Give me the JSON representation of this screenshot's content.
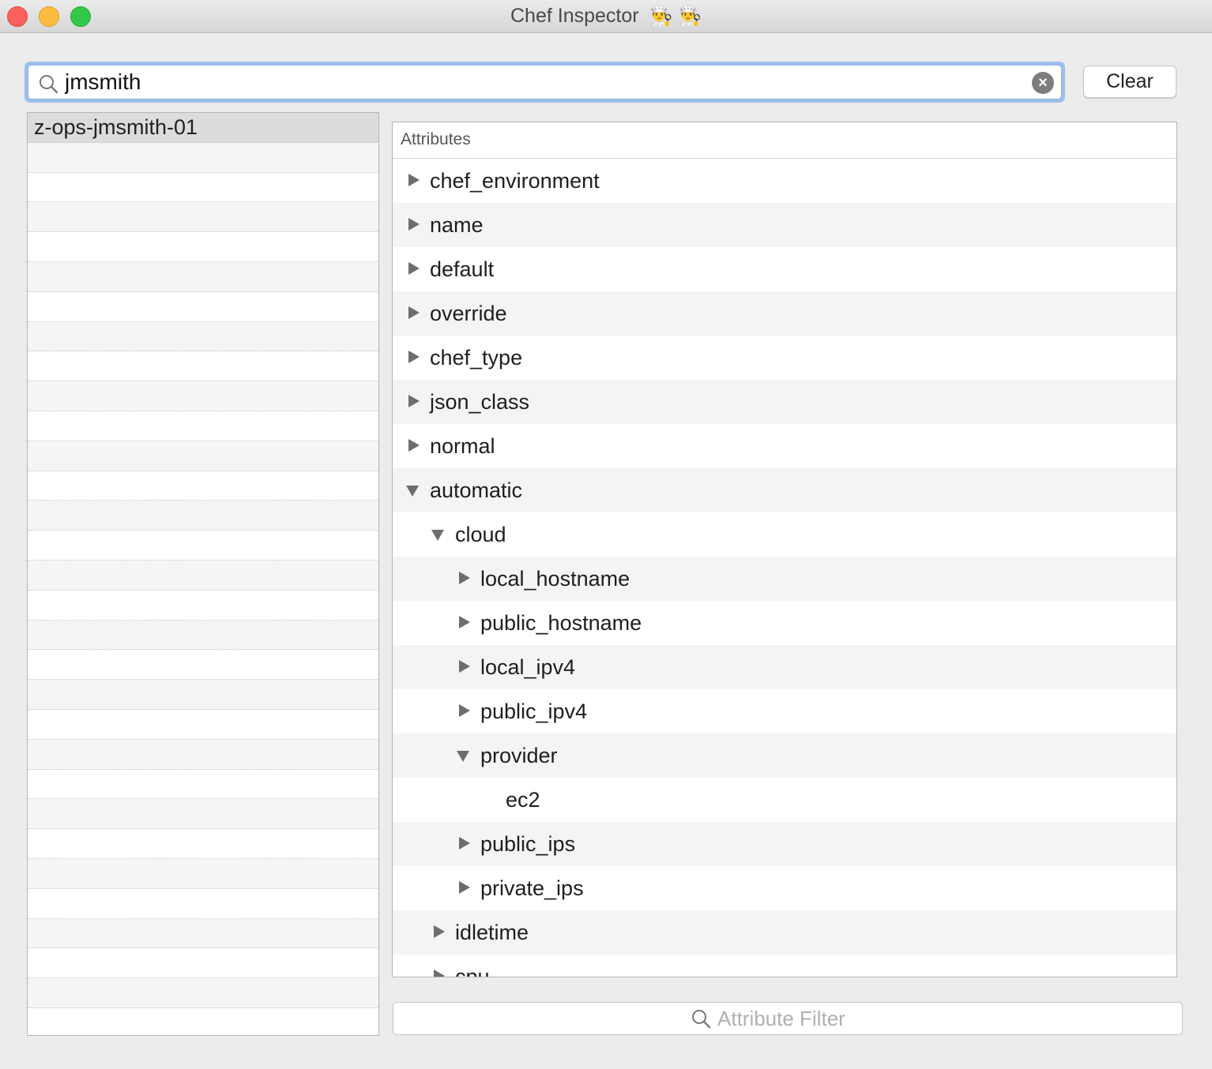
{
  "window": {
    "title": "Chef Inspector",
    "title_emoji": "👨‍🍳 👨‍🍳"
  },
  "search": {
    "value": "jmsmith",
    "clear_icon": "×"
  },
  "toolbar": {
    "clear_label": "Clear"
  },
  "nodes": {
    "items": [
      "z-ops-jmsmith-01"
    ]
  },
  "attributes": {
    "header": "Attributes",
    "rows": [
      {
        "label": "chef_environment",
        "depth": 0,
        "state": "collapsed"
      },
      {
        "label": "name",
        "depth": 0,
        "state": "collapsed"
      },
      {
        "label": "default",
        "depth": 0,
        "state": "collapsed"
      },
      {
        "label": "override",
        "depth": 0,
        "state": "collapsed"
      },
      {
        "label": "chef_type",
        "depth": 0,
        "state": "collapsed"
      },
      {
        "label": "json_class",
        "depth": 0,
        "state": "collapsed"
      },
      {
        "label": "normal",
        "depth": 0,
        "state": "collapsed"
      },
      {
        "label": "automatic",
        "depth": 0,
        "state": "expanded"
      },
      {
        "label": "cloud",
        "depth": 1,
        "state": "expanded"
      },
      {
        "label": "local_hostname",
        "depth": 2,
        "state": "collapsed"
      },
      {
        "label": "public_hostname",
        "depth": 2,
        "state": "collapsed"
      },
      {
        "label": "local_ipv4",
        "depth": 2,
        "state": "collapsed"
      },
      {
        "label": "public_ipv4",
        "depth": 2,
        "state": "collapsed"
      },
      {
        "label": "provider",
        "depth": 2,
        "state": "expanded"
      },
      {
        "label": "ec2",
        "depth": 3,
        "state": "leaf"
      },
      {
        "label": "public_ips",
        "depth": 2,
        "state": "collapsed"
      },
      {
        "label": "private_ips",
        "depth": 2,
        "state": "collapsed"
      },
      {
        "label": "idletime",
        "depth": 1,
        "state": "collapsed"
      },
      {
        "label": "cpu",
        "depth": 1,
        "state": "collapsed"
      }
    ]
  },
  "filter": {
    "placeholder": "Attribute Filter"
  }
}
